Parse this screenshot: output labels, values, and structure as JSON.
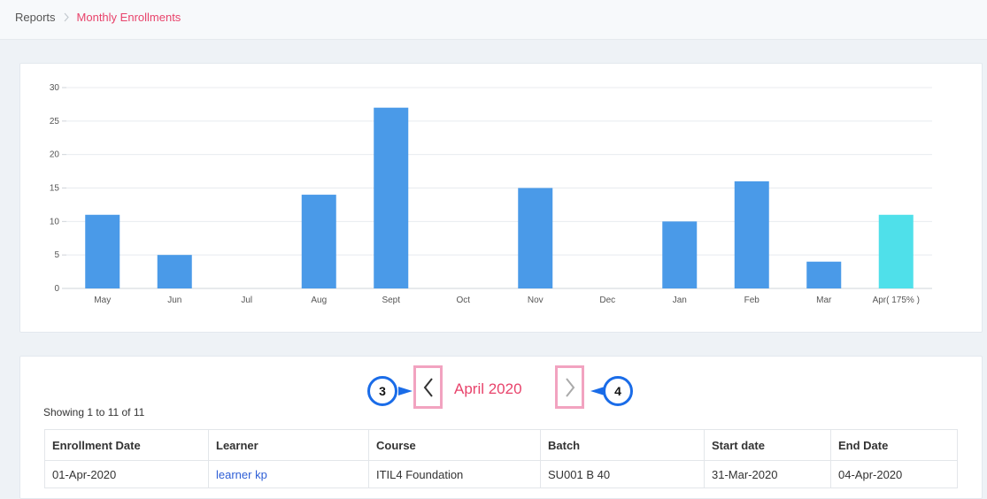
{
  "breadcrumb": {
    "root": "Reports",
    "current": "Monthly Enrollments"
  },
  "colors": {
    "bar": "#4a9ae8",
    "bar_highlight": "#4fe0ea",
    "accent": "#e8436b",
    "badge": "#1a6ce8"
  },
  "chart_data": {
    "type": "bar",
    "categories": [
      "May",
      "Jun",
      "Jul",
      "Aug",
      "Sept",
      "Oct",
      "Nov",
      "Dec",
      "Jan",
      "Feb",
      "Mar",
      "Apr( 175% )"
    ],
    "values": [
      11,
      5,
      0,
      14,
      27,
      0,
      15,
      0,
      10,
      16,
      4,
      11
    ],
    "highlight_index": 11,
    "yticks": [
      "0",
      "5",
      "10",
      "15",
      "20",
      "25",
      "30"
    ],
    "ylim": [
      0,
      30
    ],
    "grid": true
  },
  "month_nav": {
    "label": "April 2020",
    "prev_icon": "chevron-left-icon",
    "next_icon": "chevron-right-icon"
  },
  "badges": {
    "prev": "3",
    "next": "4"
  },
  "table": {
    "showing": "Showing 1 to 11 of 11",
    "headers": [
      "Enrollment Date",
      "Learner",
      "Course",
      "Batch",
      "Start date",
      "End Date"
    ],
    "rows": [
      {
        "enrollment_date": "01-Apr-2020",
        "learner": "learner kp",
        "course": "ITIL4 Foundation",
        "batch": "SU001 B 40",
        "start_date": "31-Mar-2020",
        "end_date": "04-Apr-2020"
      }
    ]
  }
}
